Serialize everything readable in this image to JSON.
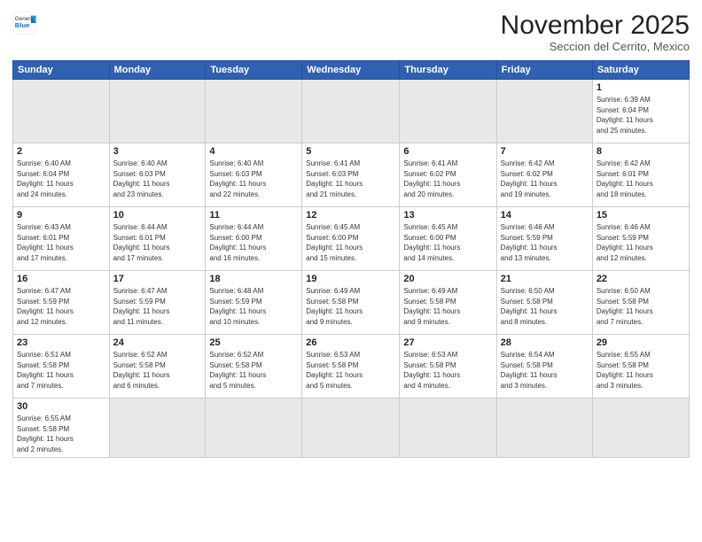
{
  "header": {
    "logo_general": "General",
    "logo_blue": "Blue",
    "month_title": "November 2025",
    "location": "Seccion del Cerrito, Mexico"
  },
  "days_of_week": [
    "Sunday",
    "Monday",
    "Tuesday",
    "Wednesday",
    "Thursday",
    "Friday",
    "Saturday"
  ],
  "weeks": [
    [
      {
        "day": "",
        "info": ""
      },
      {
        "day": "",
        "info": ""
      },
      {
        "day": "",
        "info": ""
      },
      {
        "day": "",
        "info": ""
      },
      {
        "day": "",
        "info": ""
      },
      {
        "day": "",
        "info": ""
      },
      {
        "day": "1",
        "info": "Sunrise: 6:39 AM\nSunset: 6:04 PM\nDaylight: 11 hours\nand 25 minutes."
      }
    ],
    [
      {
        "day": "2",
        "info": "Sunrise: 6:40 AM\nSunset: 6:04 PM\nDaylight: 11 hours\nand 24 minutes."
      },
      {
        "day": "3",
        "info": "Sunrise: 6:40 AM\nSunset: 6:03 PM\nDaylight: 11 hours\nand 23 minutes."
      },
      {
        "day": "4",
        "info": "Sunrise: 6:40 AM\nSunset: 6:03 PM\nDaylight: 11 hours\nand 22 minutes."
      },
      {
        "day": "5",
        "info": "Sunrise: 6:41 AM\nSunset: 6:03 PM\nDaylight: 11 hours\nand 21 minutes."
      },
      {
        "day": "6",
        "info": "Sunrise: 6:41 AM\nSunset: 6:02 PM\nDaylight: 11 hours\nand 20 minutes."
      },
      {
        "day": "7",
        "info": "Sunrise: 6:42 AM\nSunset: 6:02 PM\nDaylight: 11 hours\nand 19 minutes."
      },
      {
        "day": "8",
        "info": "Sunrise: 6:42 AM\nSunset: 6:01 PM\nDaylight: 11 hours\nand 18 minutes."
      }
    ],
    [
      {
        "day": "9",
        "info": "Sunrise: 6:43 AM\nSunset: 6:01 PM\nDaylight: 11 hours\nand 17 minutes."
      },
      {
        "day": "10",
        "info": "Sunrise: 6:44 AM\nSunset: 6:01 PM\nDaylight: 11 hours\nand 17 minutes."
      },
      {
        "day": "11",
        "info": "Sunrise: 6:44 AM\nSunset: 6:00 PM\nDaylight: 11 hours\nand 16 minutes."
      },
      {
        "day": "12",
        "info": "Sunrise: 6:45 AM\nSunset: 6:00 PM\nDaylight: 11 hours\nand 15 minutes."
      },
      {
        "day": "13",
        "info": "Sunrise: 6:45 AM\nSunset: 6:00 PM\nDaylight: 11 hours\nand 14 minutes."
      },
      {
        "day": "14",
        "info": "Sunrise: 6:46 AM\nSunset: 5:59 PM\nDaylight: 11 hours\nand 13 minutes."
      },
      {
        "day": "15",
        "info": "Sunrise: 6:46 AM\nSunset: 5:59 PM\nDaylight: 11 hours\nand 12 minutes."
      }
    ],
    [
      {
        "day": "16",
        "info": "Sunrise: 6:47 AM\nSunset: 5:59 PM\nDaylight: 11 hours\nand 12 minutes."
      },
      {
        "day": "17",
        "info": "Sunrise: 6:47 AM\nSunset: 5:59 PM\nDaylight: 11 hours\nand 11 minutes."
      },
      {
        "day": "18",
        "info": "Sunrise: 6:48 AM\nSunset: 5:59 PM\nDaylight: 11 hours\nand 10 minutes."
      },
      {
        "day": "19",
        "info": "Sunrise: 6:49 AM\nSunset: 5:58 PM\nDaylight: 11 hours\nand 9 minutes."
      },
      {
        "day": "20",
        "info": "Sunrise: 6:49 AM\nSunset: 5:58 PM\nDaylight: 11 hours\nand 9 minutes."
      },
      {
        "day": "21",
        "info": "Sunrise: 6:50 AM\nSunset: 5:58 PM\nDaylight: 11 hours\nand 8 minutes."
      },
      {
        "day": "22",
        "info": "Sunrise: 6:50 AM\nSunset: 5:58 PM\nDaylight: 11 hours\nand 7 minutes."
      }
    ],
    [
      {
        "day": "23",
        "info": "Sunrise: 6:51 AM\nSunset: 5:58 PM\nDaylight: 11 hours\nand 7 minutes."
      },
      {
        "day": "24",
        "info": "Sunrise: 6:52 AM\nSunset: 5:58 PM\nDaylight: 11 hours\nand 6 minutes."
      },
      {
        "day": "25",
        "info": "Sunrise: 6:52 AM\nSunset: 5:58 PM\nDaylight: 11 hours\nand 5 minutes."
      },
      {
        "day": "26",
        "info": "Sunrise: 6:53 AM\nSunset: 5:58 PM\nDaylight: 11 hours\nand 5 minutes."
      },
      {
        "day": "27",
        "info": "Sunrise: 6:53 AM\nSunset: 5:58 PM\nDaylight: 11 hours\nand 4 minutes."
      },
      {
        "day": "28",
        "info": "Sunrise: 6:54 AM\nSunset: 5:58 PM\nDaylight: 11 hours\nand 3 minutes."
      },
      {
        "day": "29",
        "info": "Sunrise: 6:55 AM\nSunset: 5:58 PM\nDaylight: 11 hours\nand 3 minutes."
      }
    ],
    [
      {
        "day": "30",
        "info": "Sunrise: 6:55 AM\nSunset: 5:58 PM\nDaylight: 11 hours\nand 2 minutes."
      },
      {
        "day": "",
        "info": ""
      },
      {
        "day": "",
        "info": ""
      },
      {
        "day": "",
        "info": ""
      },
      {
        "day": "",
        "info": ""
      },
      {
        "day": "",
        "info": ""
      },
      {
        "day": "",
        "info": ""
      }
    ]
  ]
}
